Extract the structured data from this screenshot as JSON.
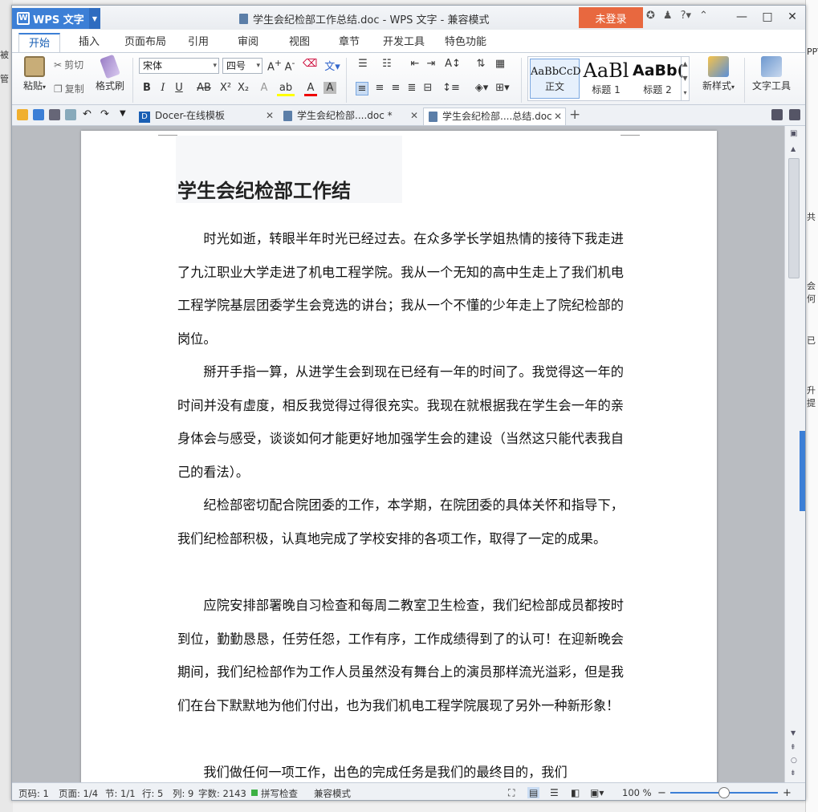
{
  "background_left": [
    "被",
    "管"
  ],
  "background_right": [
    "PPT",
    "共",
    "会",
    "何",
    "已",
    "升",
    "提"
  ],
  "app": {
    "name": "WPS 文字",
    "login_label": "未登录"
  },
  "window": {
    "title": "学生会纪检部工作总结.doc - WPS 文字 - 兼容模式"
  },
  "ribbon_tabs": [
    "开始",
    "插入",
    "页面布局",
    "引用",
    "审阅",
    "视图",
    "章节",
    "开发工具",
    "特色功能"
  ],
  "ribbon": {
    "paste": "粘贴",
    "cut": "剪切",
    "copy": "复制",
    "format_painter": "格式刷",
    "font_name": "宋体",
    "font_size": "四号",
    "styles": [
      {
        "sample": "AaBbCcD",
        "label": "正文"
      },
      {
        "sample": "AaBl",
        "label": "标题 1"
      },
      {
        "sample": "AaBb(",
        "label": "标题 2"
      }
    ],
    "new_style": "新样式",
    "text_tools": "文字工具"
  },
  "doc_tabs": [
    {
      "label": "Docer-在线模板"
    },
    {
      "label": "学生会纪检部....doc *"
    },
    {
      "label": "学生会纪检部....总结.doc"
    }
  ],
  "document": {
    "title": "学生会纪检部工作结",
    "paragraphs": [
      "时光如逝，转眼半年时光已经过去。在众多学长学姐热情的接待下我走进了九江职业大学走进了机电工程学院。我从一个无知的高中生走上了我们机电工程学院基层团委学生会竞选的讲台；我从一个不懂的少年走上了院纪检部的岗位。",
      "掰开手指一算，从进学生会到现在已经有一年的时间了。我觉得这一年的时间并没有虚度，相反我觉得过得很充实。我现在就根据我在学生会一年的亲身体会与感受，谈谈如何才能更好地加强学生会的建设（当然这只能代表我自己的看法）。",
      "纪检部密切配合院团委的工作，本学期，在院团委的具体关怀和指导下，我们纪检部积极，认真地完成了学校安排的各项工作，取得了一定的成果。",
      "应院安排部署晚自习检查和每周二教室卫生检查，我们纪检部成员都按时到位，勤勤恳恳，任劳任怨，工作有序，工作成绩得到了的认可！在迎新晚会期间，我们纪检部作为工作人员虽然没有舞台上的演员那样流光溢彩，但是我们在台下默默地为他们付出，也为我们机电工程学院展现了另外一种新形象！",
      "我们做任何一项工作，出色的完成任务是我们的最终目的，我们"
    ]
  },
  "status": {
    "page_code": "页码: 1",
    "pages": "页面: 1/4",
    "section": "节: 1/1",
    "row": "行: 5",
    "col": "列: 9",
    "word_count": "字数: 2143",
    "spell_check": "拼写检查",
    "mode": "兼容模式",
    "zoom": "100 %"
  }
}
